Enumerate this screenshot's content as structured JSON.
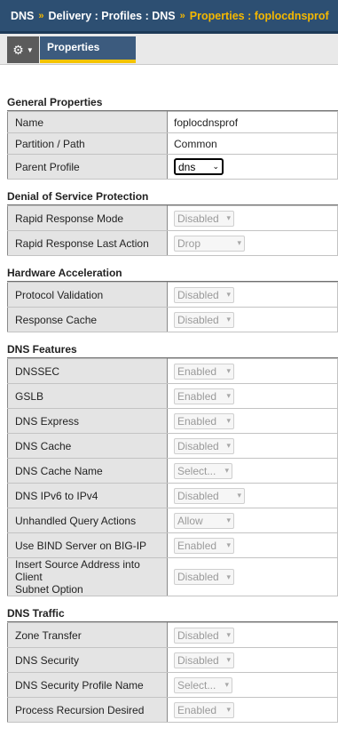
{
  "breadcrumb": {
    "items": [
      "DNS",
      "Delivery : Profiles : DNS"
    ],
    "current": "Properties : foplocdnsprof",
    "separator": "»"
  },
  "toolbar": {
    "gear_icon": "gear-icon",
    "tab_label": "Properties"
  },
  "sections": {
    "general": {
      "title": "General Properties",
      "name_label": "Name",
      "name_value": "foplocdnsprof",
      "partition_label": "Partition / Path",
      "partition_value": "Common",
      "parent_label": "Parent Profile",
      "parent_value": "dns"
    },
    "dos": {
      "title": "Denial of Service Protection",
      "rrm_label": "Rapid Response Mode",
      "rrm_value": "Disabled",
      "rrla_label": "Rapid Response Last Action",
      "rrla_value": "Drop"
    },
    "hw": {
      "title": "Hardware Acceleration",
      "pv_label": "Protocol Validation",
      "pv_value": "Disabled",
      "rc_label": "Response Cache",
      "rc_value": "Disabled"
    },
    "features": {
      "title": "DNS Features",
      "dnssec_label": "DNSSEC",
      "dnssec_value": "Enabled",
      "gslb_label": "GSLB",
      "gslb_value": "Enabled",
      "express_label": "DNS Express",
      "express_value": "Enabled",
      "cache_label": "DNS Cache",
      "cache_value": "Disabled",
      "cache_name_label": "DNS Cache Name",
      "cache_name_value": "Select...",
      "ipv6_label": "DNS IPv6 to IPv4",
      "ipv6_value": "Disabled",
      "unhandled_label": "Unhandled Query Actions",
      "unhandled_value": "Allow",
      "bind_label": "Use BIND Server on BIG-IP",
      "bind_value": "Enabled",
      "subnet_label_1": "Insert Source Address into Client",
      "subnet_label_2": "Subnet Option",
      "subnet_value": "Disabled"
    },
    "traffic": {
      "title": "DNS Traffic",
      "zt_label": "Zone Transfer",
      "zt_value": "Disabled",
      "sec_label": "DNS Security",
      "sec_value": "Disabled",
      "secprof_label": "DNS Security Profile Name",
      "secprof_value": "Select...",
      "recursion_label": "Process Recursion Desired",
      "recursion_value": "Enabled"
    }
  },
  "colors": {
    "header_bg": "#2d4f72",
    "accent": "#f5b800",
    "tab_bg": "#3c5b7e"
  }
}
